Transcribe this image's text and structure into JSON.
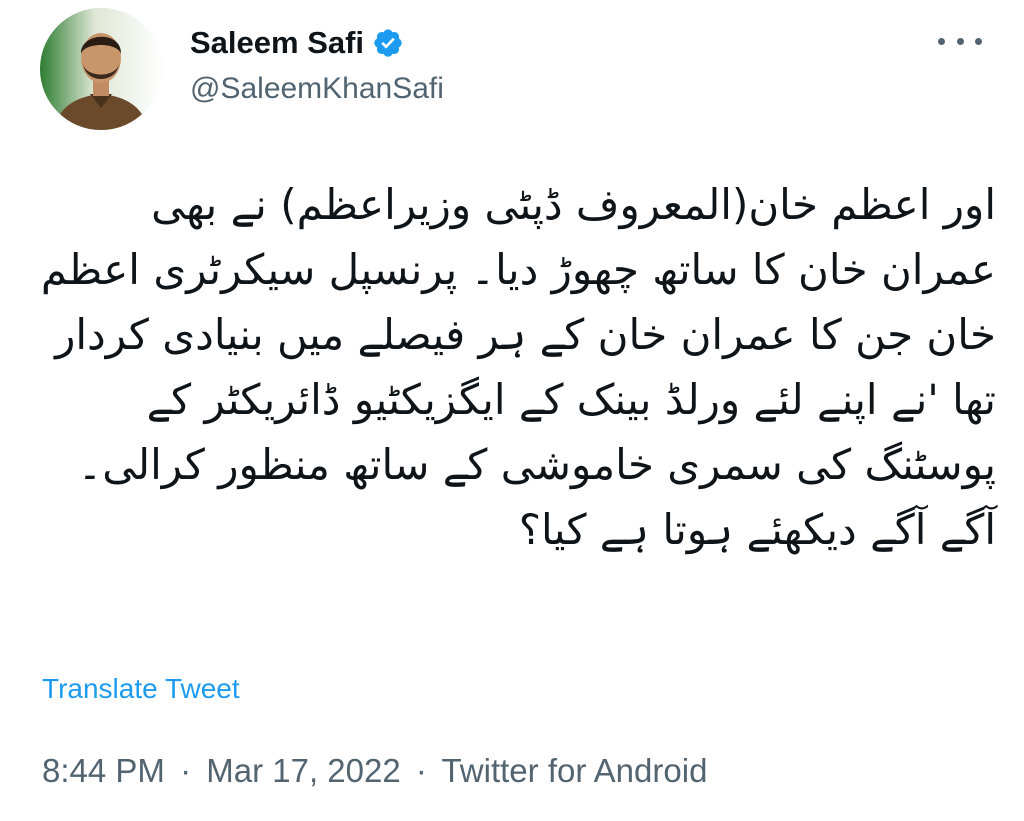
{
  "author": {
    "display_name": "Saleem Safi",
    "handle": "@SaleemKhanSafi",
    "verified": true
  },
  "tweet": {
    "text": "اور اعظم خان(المعروف ڈپٹی وزیراعظم) نے بھی عمران خان کا ساتھ چھوڑ دیا۔ پرنسپل سیکرٹری اعظم خان جن کا عمران خان کے ہر فیصلے میں بنیادی کردار تھا 'نے اپنے لئے ورلڈ بینک کے ایگزیکٹیو ڈائریکٹر کے پوسٹنگ کی سمری خاموشی کے ساتھ منظور کرالی۔ آگے آگے دیکھئے ہوتا ہے کیا؟",
    "translate_label": "Translate Tweet",
    "time": "8:44 PM",
    "date": "Mar 17, 2022",
    "separator": "·",
    "source": "Twitter for Android"
  },
  "icons": {
    "avatar": "profile-photo",
    "verified": "verified-badge-icon",
    "more": "more-horizontal-icon"
  },
  "colors": {
    "link": "#1d9bf0",
    "secondary_text": "#536471",
    "primary_text": "#0f1419",
    "verified_badge": "#1d9bf0"
  }
}
